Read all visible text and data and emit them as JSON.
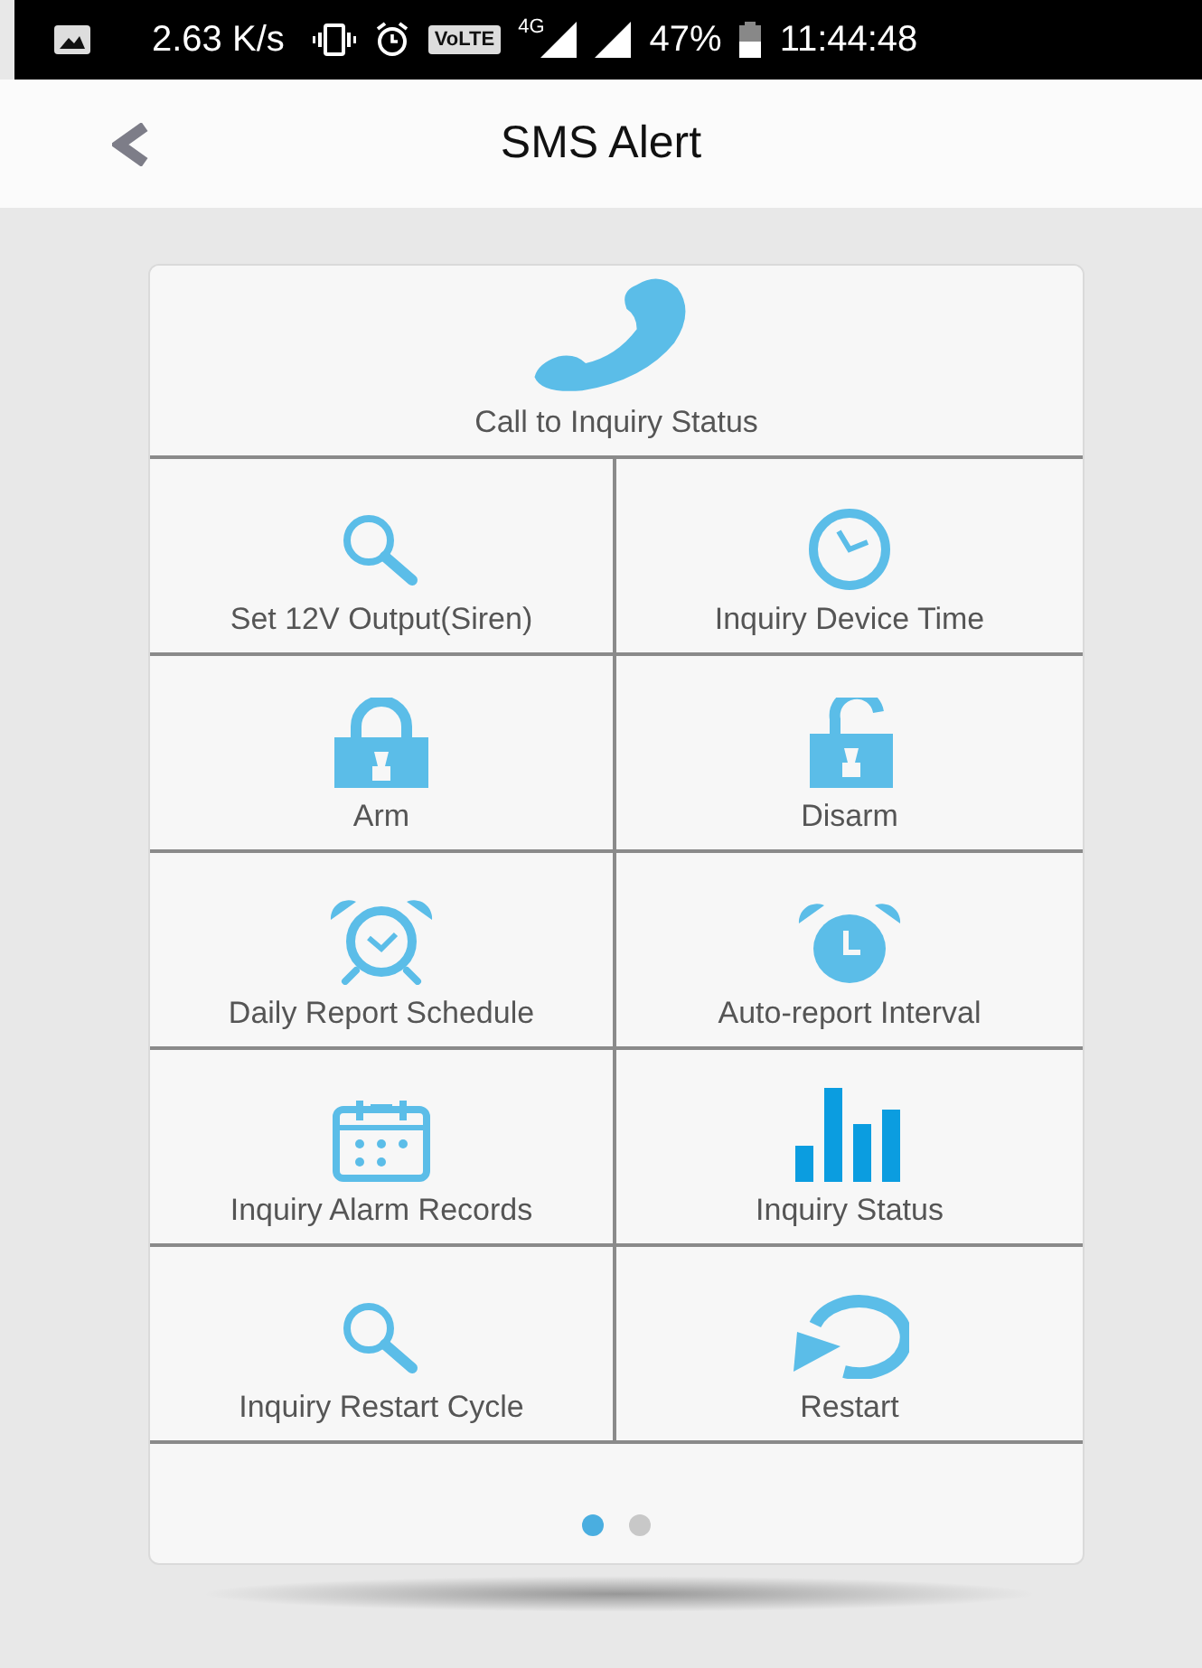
{
  "status_bar": {
    "speed": "2.63 K/s",
    "volte": "VoLTE",
    "network": "4G",
    "battery": "47%",
    "time": "11:44:48"
  },
  "header": {
    "title": "SMS Alert"
  },
  "top_action": {
    "label": "Call to Inquiry Status",
    "kind": "phone"
  },
  "actions": [
    {
      "label": "Set 12V Output(Siren)",
      "kind": "search"
    },
    {
      "label": "Inquiry Device Time",
      "kind": "clock"
    },
    {
      "label": "Arm",
      "kind": "lock"
    },
    {
      "label": "Disarm",
      "kind": "unlock"
    },
    {
      "label": "Daily Report Schedule",
      "kind": "alarm"
    },
    {
      "label": "Auto-report Interval",
      "kind": "timer"
    },
    {
      "label": "Inquiry Alarm Records",
      "kind": "calendar"
    },
    {
      "label": "Inquiry Status",
      "kind": "chart"
    },
    {
      "label": "Inquiry Restart Cycle",
      "kind": "search"
    },
    {
      "label": "Restart",
      "kind": "restart"
    }
  ],
  "pager": [
    {
      "selected": true
    },
    {
      "selected": false
    }
  ]
}
